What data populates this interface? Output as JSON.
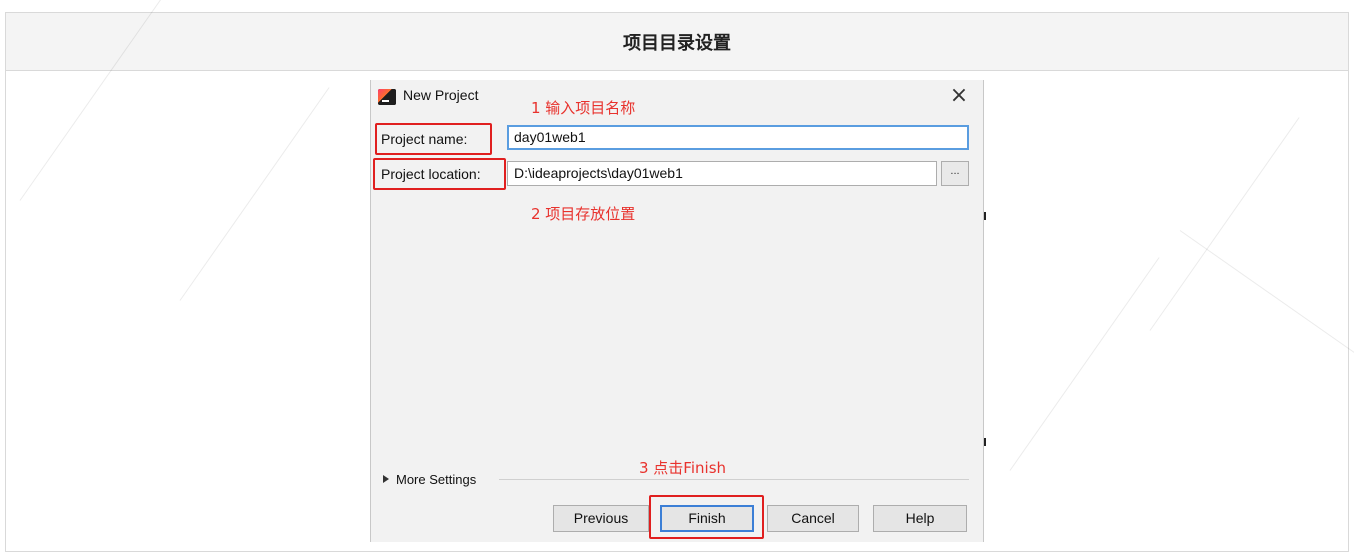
{
  "frame": {
    "title": "项目目录设置"
  },
  "dialog": {
    "title": "New Project",
    "close_icon": "close-icon",
    "project_name": {
      "label": "Project name:",
      "value": "day01web1"
    },
    "project_location": {
      "label": "Project location:",
      "value": "D:\\ideaprojects\\day01web1",
      "browse_label": "..."
    },
    "more_settings": "More Settings",
    "buttons": {
      "previous": "Previous",
      "finish": "Finish",
      "cancel": "Cancel",
      "help": "Help"
    }
  },
  "annotations": {
    "step1": "1 输入项目名称",
    "step2": "2 项目存放位置",
    "step3": "3 点击Finish"
  },
  "colors": {
    "annotation_red": "#e8322d",
    "focus_blue": "#5a9de0",
    "dialog_bg": "#f2f2f2",
    "header_bg": "#f4f4f4"
  }
}
